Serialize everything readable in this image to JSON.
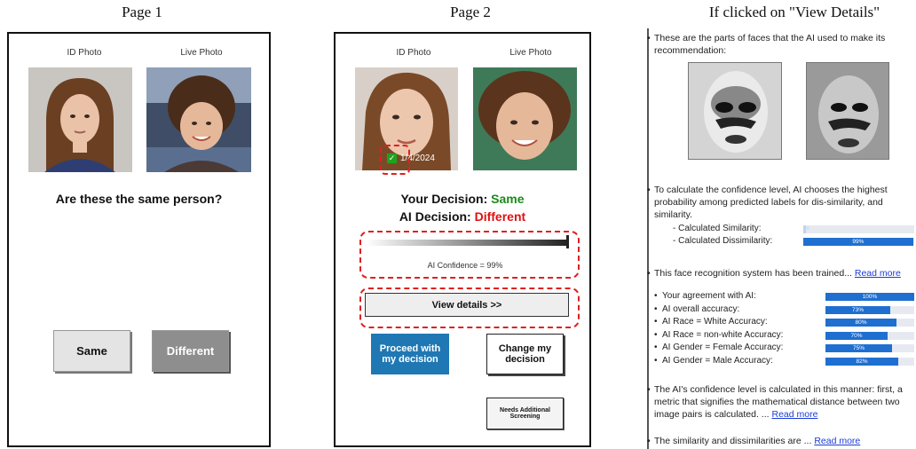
{
  "captions": {
    "page1": "Page 1",
    "page2": "Page 2",
    "details": "If clicked on \"View Details\""
  },
  "page1": {
    "id_label": "ID Photo",
    "live_label": "Live Photo",
    "question": "Are these the same person?",
    "same_btn": "Same",
    "different_btn": "Different"
  },
  "page2": {
    "id_label": "ID Photo",
    "live_label": "Live Photo",
    "date_overlay": "1/4/2024",
    "your_decision_label": "Your Decision:",
    "your_decision_value": "Same",
    "ai_decision_label": "AI Decision:",
    "ai_decision_value": "Different",
    "confidence_text": "AI Confidence = 99%",
    "view_details_btn": "View details >>",
    "proceed_btn_line1": "Proceed with",
    "proceed_btn_line2": "my decision",
    "change_btn_line1": "Change my",
    "change_btn_line2": "decision",
    "screening_btn_line1": "Needs Additional",
    "screening_btn_line2": "Screening"
  },
  "details": {
    "b1_line1": "These are the parts of faces that the AI used to make its",
    "b1_line2": "recommendation:",
    "b2_line1": "To calculate the confidence level, AI chooses the highest",
    "b2_line2": "probability among predicted labels for dis-similarity, and",
    "b2_line3": "similarity.",
    "calc_sim_label": "- Calculated Similarity:",
    "calc_sim_value": "1%",
    "calc_dis_label": "- Calculated Dissimilarity:",
    "calc_dis_value": "99%",
    "b3_text": "This face recognition system has been trained...",
    "read_more": "Read more",
    "metrics": [
      {
        "label": "Your agreement with AI:",
        "value": "100%",
        "pct": 100
      },
      {
        "label": "AI overall accuracy:",
        "value": "73%",
        "pct": 73
      },
      {
        "label": "AI Race = White Accuracy:",
        "value": "80%",
        "pct": 80
      },
      {
        "label": "AI Race = non-white Accuracy:",
        "value": "70%",
        "pct": 70
      },
      {
        "label": "AI Gender = Female Accuracy:",
        "value": "75%",
        "pct": 75
      },
      {
        "label": "AI Gender = Male Accuracy:",
        "value": "82%",
        "pct": 82
      }
    ],
    "b4_line1": "The AI's confidence level is calculated in this manner: first, a",
    "b4_line2": "metric that signifies the mathematical distance between two",
    "b4_line3": "image pairs is calculated. ...",
    "b5_text": "The similarity and dissimilarities are ...",
    "colors": {
      "bar_fill": "#1f6fd1",
      "link": "#1a3cd6",
      "same": "#1a8a1a",
      "different": "#e01010",
      "proceed": "#1f78b4"
    }
  }
}
